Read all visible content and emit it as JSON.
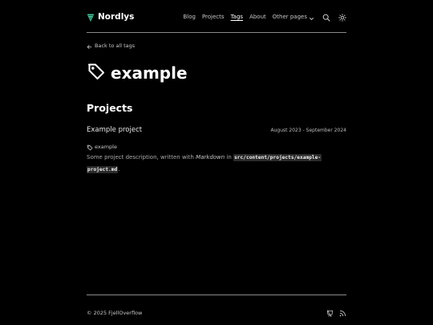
{
  "header": {
    "brand": "Nordlys",
    "nav": [
      {
        "label": "Blog",
        "active": false
      },
      {
        "label": "Projects",
        "active": false
      },
      {
        "label": "Tags",
        "active": true
      },
      {
        "label": "About",
        "active": false
      }
    ],
    "dropdown_label": "Other pages",
    "brand_icon": "tree-icon",
    "brand_color": "#3fbf8f"
  },
  "back_link": "Back to all tags",
  "page_title": "example",
  "section_title": "Projects",
  "project": {
    "name": "Example project",
    "date_range": "August 2023 - September 2024",
    "tag": "example",
    "desc_prefix": "Some project description, written with ",
    "desc_em": "Markdown",
    "desc_mid": " in ",
    "desc_code_1": "src/content/projects/example-",
    "desc_code_2": "project.md",
    "desc_suffix": "."
  },
  "footer": {
    "copyright": "© 2025 FjellOverflow",
    "icons": [
      "github-icon",
      "rss-icon"
    ]
  }
}
